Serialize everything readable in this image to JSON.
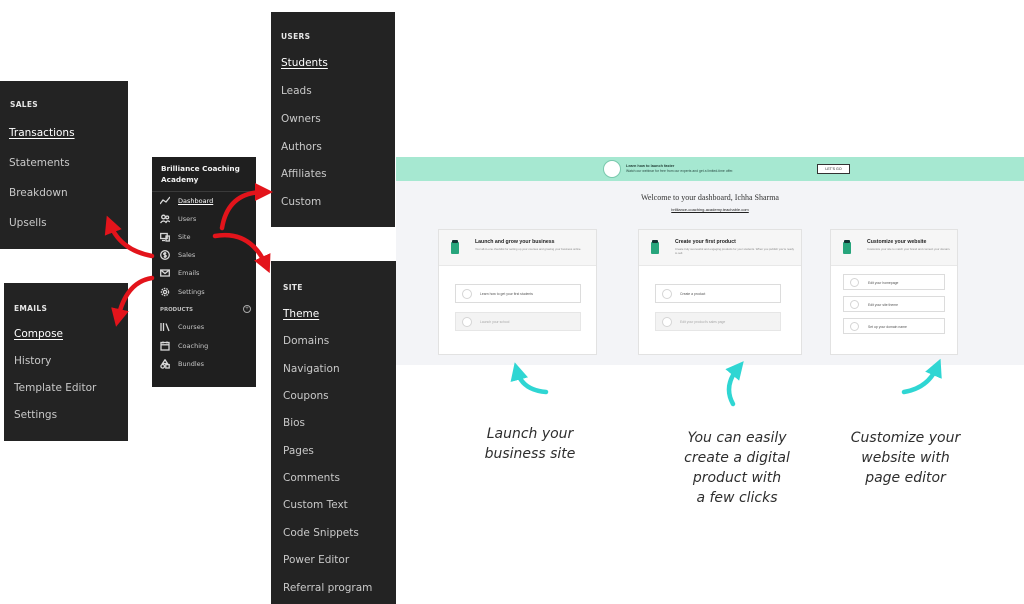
{
  "sales_menu": {
    "heading": "SALES",
    "items": [
      {
        "label": "Transactions",
        "active": true
      },
      {
        "label": "Statements",
        "active": false
      },
      {
        "label": "Breakdown",
        "active": false
      },
      {
        "label": "Upsells",
        "active": false
      }
    ]
  },
  "users_menu": {
    "heading": "USERS",
    "items": [
      {
        "label": "Students",
        "active": true
      },
      {
        "label": "Leads",
        "active": false
      },
      {
        "label": "Owners",
        "active": false
      },
      {
        "label": "Authors",
        "active": false
      },
      {
        "label": "Affiliates",
        "active": false
      },
      {
        "label": "Custom",
        "active": false
      }
    ]
  },
  "emails_menu": {
    "heading": "EMAILS",
    "items": [
      {
        "label": "Compose",
        "active": true
      },
      {
        "label": "History",
        "active": false
      },
      {
        "label": "Template Editor",
        "active": false
      },
      {
        "label": "Settings",
        "active": false
      }
    ]
  },
  "site_menu": {
    "heading": "SITE",
    "items": [
      {
        "label": "Theme",
        "active": true
      },
      {
        "label": "Domains",
        "active": false
      },
      {
        "label": "Navigation",
        "active": false
      },
      {
        "label": "Coupons",
        "active": false
      },
      {
        "label": "Bios",
        "active": false
      },
      {
        "label": "Pages",
        "active": false
      },
      {
        "label": "Comments",
        "active": false
      },
      {
        "label": "Custom Text",
        "active": false
      },
      {
        "label": "Code Snippets",
        "active": false
      },
      {
        "label": "Power Editor",
        "active": false
      },
      {
        "label": "Referral program",
        "active": false
      }
    ]
  },
  "sidebar": {
    "brand": "Brilliance Coaching Academy",
    "items": [
      {
        "label": "Dashboard",
        "icon": "trend-icon",
        "active": true
      },
      {
        "label": "Users",
        "icon": "users-icon",
        "active": false
      },
      {
        "label": "Site",
        "icon": "site-icon",
        "active": false
      },
      {
        "label": "Sales",
        "icon": "dollar-icon",
        "active": false
      },
      {
        "label": "Emails",
        "icon": "mail-icon",
        "active": false
      },
      {
        "label": "Settings",
        "icon": "gear-icon",
        "active": false
      }
    ],
    "products_heading": "PRODUCTS",
    "products": [
      {
        "label": "Courses",
        "icon": "library-icon"
      },
      {
        "label": "Coaching",
        "icon": "calendar-icon"
      },
      {
        "label": "Bundles",
        "icon": "shapes-icon"
      }
    ]
  },
  "dashboard": {
    "banner_title": "Learn how to launch faster",
    "banner_text": "Watch our webinar for free from our experts and get a limited-time offer.",
    "banner_button": "LET'S GO",
    "welcome": "Welcome to your dashboard, Ichha Sharma",
    "school_url": "brilliance-coaching-academy.teachable.com",
    "cards": [
      {
        "title": "Launch and grow your business",
        "desc": "Your all-in-one checklist for setting up your courses and growing your business online.",
        "tasks": [
          {
            "label": "Learn how to get your first students",
            "done": false
          },
          {
            "label": "Launch your school",
            "done": true
          }
        ]
      },
      {
        "title": "Create your first product",
        "desc": "Create truly successful and engaging products for your students. When you publish you're ready to sell.",
        "tasks": [
          {
            "label": "Create a product",
            "done": false
          },
          {
            "label": "Edit your product's sales page",
            "done": true
          }
        ]
      },
      {
        "title": "Customize your website",
        "desc": "Customize your site to match your brand and connect your domain.",
        "tasks": [
          {
            "label": "Edit your homepage",
            "done": false
          },
          {
            "label": "Edit your site theme",
            "done": false
          },
          {
            "label": "Set up your domain name",
            "done": false
          }
        ]
      }
    ]
  },
  "captions": {
    "launch": "Launch your\nbusiness site",
    "create": "You can easily\ncreate a digital\nproduct with\na few clicks",
    "customize": "Customize your\nwebsite with\npage editor"
  },
  "colors": {
    "panel_bg": "#232323",
    "banner": "#a6e8d1",
    "accent_green": "#27a57c",
    "red_arrow": "#e3141b",
    "cyan_arrow": "#2fd6d3"
  }
}
